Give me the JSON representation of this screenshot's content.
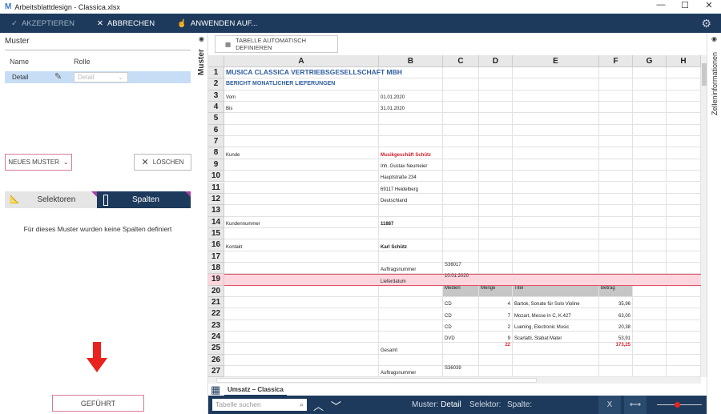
{
  "window": {
    "title": "Arbeitsblattdesign - Classica.xlsx",
    "controls": [
      "—",
      "☐",
      "✕"
    ]
  },
  "toolbar": {
    "accept": "AKZEPTIEREN",
    "cancel": "ABBRECHEN",
    "apply": "ANWENDEN AUF..."
  },
  "left": {
    "title": "Muster",
    "col_name": "Name",
    "col_role": "Rolle",
    "pattern": {
      "name": "Detail",
      "role": "Detail"
    },
    "new_pattern": "NEUES MUSTER",
    "delete": "LÖSCHEN",
    "tab_selectors": "Selektoren",
    "tab_columns": "Spalten",
    "empty_message": "Für dieses Muster wurden keine Spalten definiert",
    "guided": "GEFÜHRT"
  },
  "side_left_label": "Muster",
  "side_right_label": "Zelleninformationen",
  "main": {
    "auto_define": "TABELLE AUTOMATISCH DEFINIEREN",
    "sheet_tab": "Umsatz – Classica"
  },
  "grid": {
    "columns": [
      "A",
      "B",
      "C",
      "D",
      "E",
      "F",
      "G",
      "H"
    ],
    "rows": [
      {
        "n": "1",
        "A": "MUSICA CLASSICA VERTRIEBSGESELLSCHAFT MBH"
      },
      {
        "n": "2",
        "A": "BERICHT MONATLICHER LIEFERUNGEN"
      },
      {
        "n": "3",
        "A": "Vom",
        "B": "01.01.2020"
      },
      {
        "n": "4",
        "A": "Bis",
        "B": "31.01.2020"
      },
      {
        "n": "5"
      },
      {
        "n": "6"
      },
      {
        "n": "7"
      },
      {
        "n": "8",
        "A": "Kunde",
        "B": "Musikgeschäft Schütz"
      },
      {
        "n": "9",
        "B": "Inh. Gustav Neumeier"
      },
      {
        "n": "10",
        "B": "Hauptstraße 234"
      },
      {
        "n": "11",
        "B": "69117 Heidelberg"
      },
      {
        "n": "12",
        "B": "Deutschland"
      },
      {
        "n": "13"
      },
      {
        "n": "14",
        "A": "Kundennummer",
        "B": "11887"
      },
      {
        "n": "15"
      },
      {
        "n": "16",
        "A": "Kontakt",
        "B": "Karl Schütz"
      },
      {
        "n": "17"
      },
      {
        "n": "18",
        "B": "Auftragsnummer",
        "C": "S36017"
      },
      {
        "n": "19",
        "B": "Lieferdatum",
        "C": "10.01.2020"
      },
      {
        "n": "20",
        "C": "Medien",
        "D": "Menge",
        "E": "Titel",
        "F": "Betrag"
      },
      {
        "n": "21",
        "C": "CD",
        "D": "4",
        "E": "Bartok, Sonate für Solo Violine",
        "F": "35,96"
      },
      {
        "n": "22",
        "C": "CD",
        "D": "7",
        "E": "Mozart, Messe in C, K.427",
        "F": "63,00"
      },
      {
        "n": "23",
        "C": "CD",
        "D": "2",
        "E": "Luening, Electronic Music",
        "F": "20,38"
      },
      {
        "n": "24",
        "C": "DVD",
        "D": "9",
        "E": "Scarlatti, Stabat Mater",
        "F": "53,91"
      },
      {
        "n": "25",
        "B": "Gesamt",
        "D": "22",
        "F": "173,25"
      },
      {
        "n": "26"
      },
      {
        "n": "27",
        "B": "Auftragsnummer",
        "C": "S36039"
      }
    ]
  },
  "status": {
    "search_placeholder": "Tabelle suchen",
    "pattern_label": "Muster:",
    "pattern_value": "Detail",
    "selector_label": "Selektor:",
    "column_label": "Spalte:",
    "zoom_level": 0.45
  },
  "colors": {
    "toolbar": "#1d3a5c",
    "selection": "#c7ddf5",
    "highlight_row": "#fcd5dd",
    "accent_red": "#e0202a",
    "title_blue": "#2e5d9f"
  }
}
